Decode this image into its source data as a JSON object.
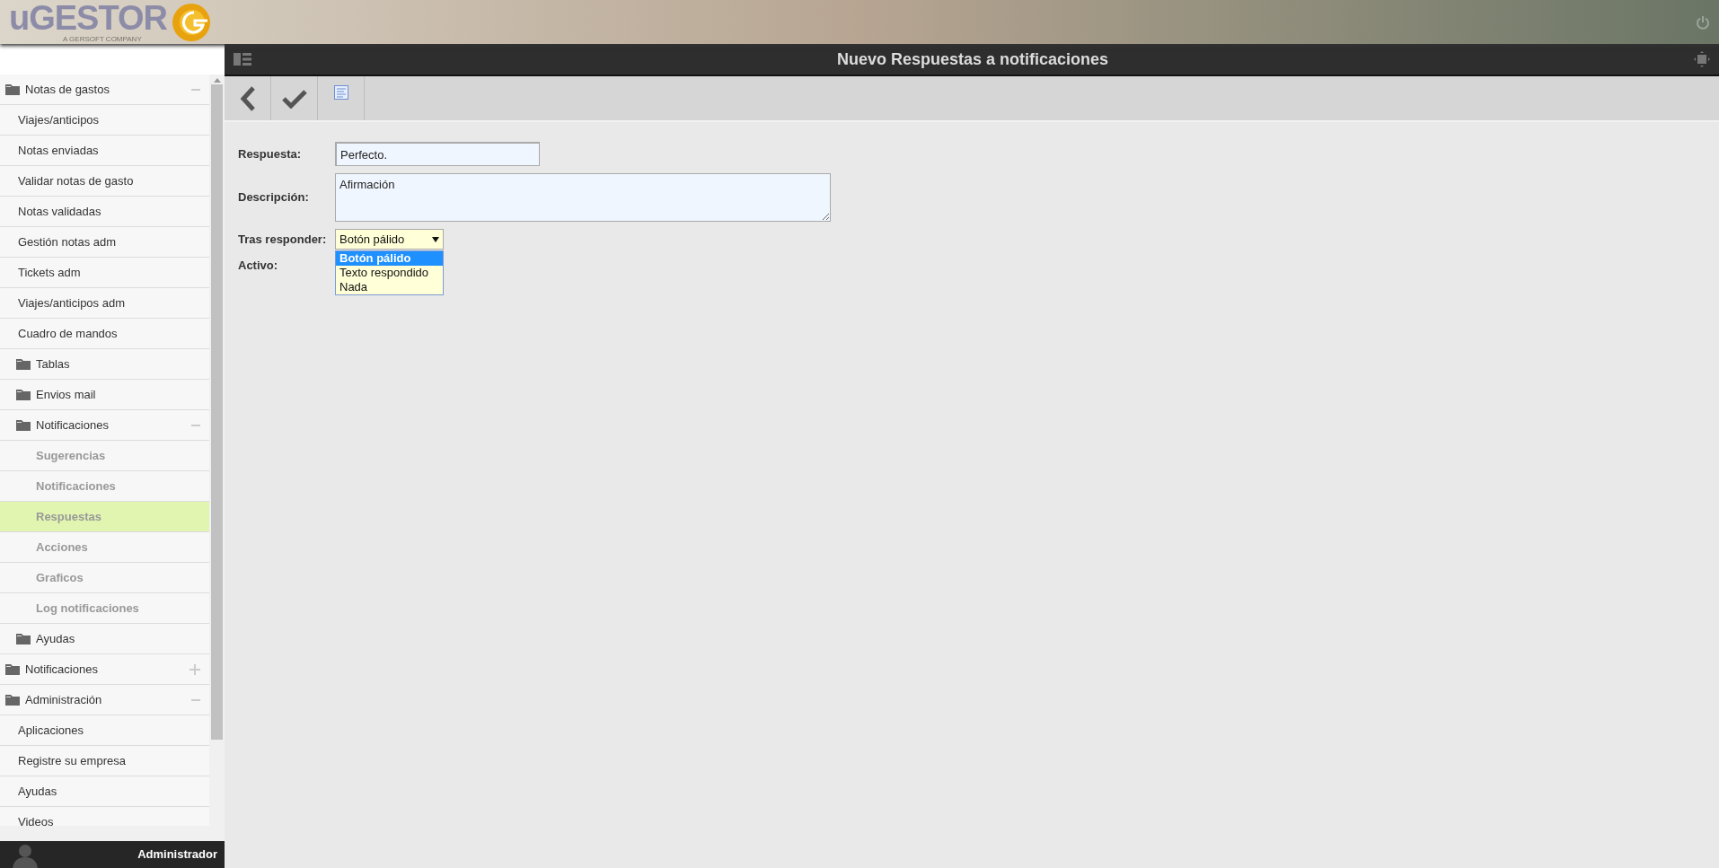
{
  "header": {
    "logo_text": "uGESTOR",
    "logo_tagline": "A GERSOFT COMPANY"
  },
  "title": "Nuevo Respuestas a notificaciones",
  "sidebar": {
    "items": [
      {
        "kind": "folder",
        "label": "Notas de gastos",
        "expanded": true,
        "children": [
          {
            "kind": "link",
            "label": "Viajes/anticipos",
            "selected": false
          },
          {
            "kind": "link",
            "label": "Notas enviadas",
            "selected": false
          },
          {
            "kind": "link",
            "label": "Validar notas de gasto",
            "selected": false
          },
          {
            "kind": "link",
            "label": "Notas validadas",
            "selected": false
          },
          {
            "kind": "link",
            "label": "Gestión notas adm",
            "selected": false
          },
          {
            "kind": "link",
            "label": "Tickets adm",
            "selected": false
          },
          {
            "kind": "link",
            "label": "Viajes/anticipos adm",
            "selected": false
          },
          {
            "kind": "link",
            "label": "Cuadro de mandos",
            "selected": false
          },
          {
            "kind": "folder",
            "label": "Tablas"
          },
          {
            "kind": "folder",
            "label": "Envios mail"
          },
          {
            "kind": "folder",
            "label": "Notificaciones",
            "expanded": true,
            "children": [
              {
                "kind": "link",
                "label": "Sugerencias",
                "selected": false
              },
              {
                "kind": "link",
                "label": "Notificaciones",
                "selected": false
              },
              {
                "kind": "link",
                "label": "Respuestas",
                "selected": true
              },
              {
                "kind": "link",
                "label": "Acciones",
                "selected": false
              },
              {
                "kind": "link",
                "label": "Graficos",
                "selected": false
              },
              {
                "kind": "link",
                "label": "Log notificaciones",
                "selected": false
              }
            ]
          },
          {
            "kind": "folder",
            "label": "Ayudas"
          }
        ]
      },
      {
        "kind": "folder",
        "label": "Notificaciones",
        "expanded": false
      },
      {
        "kind": "folder",
        "label": "Administración",
        "expanded": true,
        "children": [
          {
            "kind": "link",
            "label": "Aplicaciones",
            "selected": false
          },
          {
            "kind": "link",
            "label": "Registre su empresa",
            "selected": false
          },
          {
            "kind": "link",
            "label": "Ayudas",
            "selected": false
          },
          {
            "kind": "link",
            "label": "Videos",
            "selected": false
          }
        ]
      }
    ]
  },
  "user": {
    "name": "Administrador"
  },
  "form": {
    "fields": [
      {
        "kind": "text",
        "label": "Respuesta:",
        "value": "Perfecto."
      },
      {
        "kind": "textarea",
        "label": "Descripción:",
        "value": "Afirmación"
      },
      {
        "kind": "select",
        "label": "Tras responder:",
        "value": "Botón pálido",
        "open": true,
        "options": [
          {
            "label": "Botón pálido",
            "selected": true
          },
          {
            "label": "Texto respondido",
            "selected": false
          },
          {
            "label": "Nada",
            "selected": false
          }
        ]
      },
      {
        "kind": "label",
        "label": "Activo:"
      }
    ]
  }
}
